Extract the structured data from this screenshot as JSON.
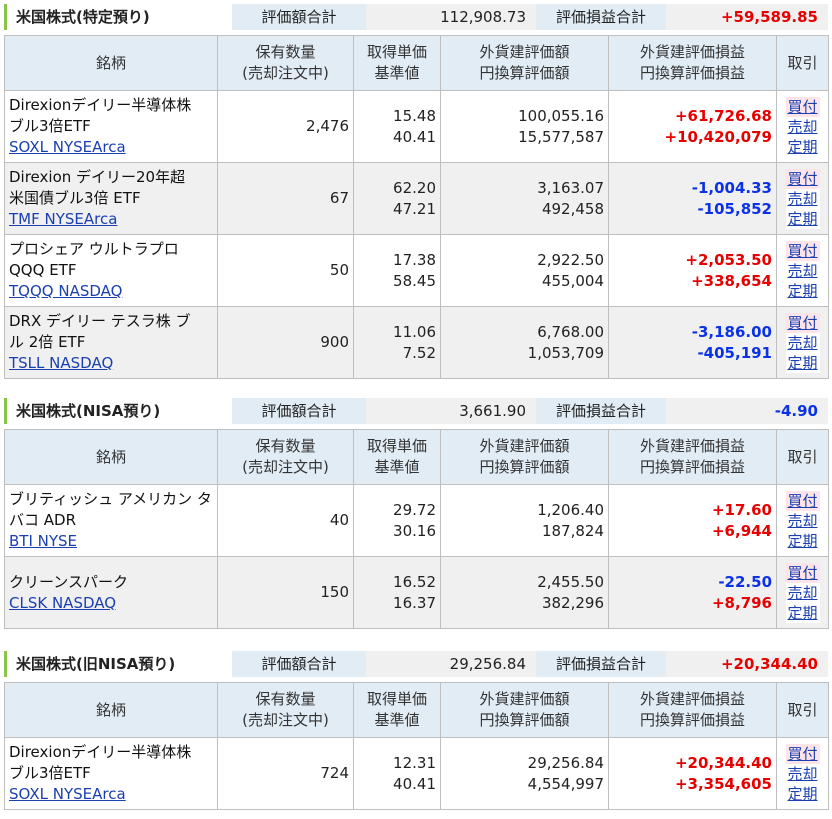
{
  "columns": {
    "name": "銘柄",
    "qty": [
      "保有数量",
      "(売却注文中)"
    ],
    "cost": [
      "取得単価",
      "基準値"
    ],
    "value": [
      "外貨建評価額",
      "円換算評価額"
    ],
    "pl": [
      "外貨建評価損益",
      "円換算評価損益"
    ],
    "trade": "取引"
  },
  "actions": {
    "buy": "買付",
    "sell": "売却",
    "fixed": "定期"
  },
  "sections": [
    {
      "title": "米国株式(特定預り)",
      "eval_label": "評価額合計",
      "eval_total": "112,908.73",
      "pl_label": "評価損益合計",
      "pl_total": "+59,589.85",
      "rows": [
        {
          "name": [
            "Direxionデイリー半導体株",
            "ブル3倍ETF"
          ],
          "ticker": "SOXL NYSEArca",
          "qty": "2,476",
          "cost": "15.48",
          "base": "40.41",
          "value_fx": "100,055.16",
          "value_jpy": "15,577,587",
          "pl_fx": "+61,726.68",
          "pl_jpy": "+10,420,079"
        },
        {
          "name": [
            "Direxion デイリー20年超",
            "米国債ブル3倍 ETF"
          ],
          "ticker": "TMF NYSEArca",
          "qty": "67",
          "cost": "62.20",
          "base": "47.21",
          "value_fx": "3,163.07",
          "value_jpy": "492,458",
          "pl_fx": "-1,004.33",
          "pl_jpy": "-105,852"
        },
        {
          "name": [
            "プロシェア ウルトラプロ",
            "QQQ ETF"
          ],
          "ticker": "TQQQ NASDAQ",
          "qty": "50",
          "cost": "17.38",
          "base": "58.45",
          "value_fx": "2,922.50",
          "value_jpy": "455,004",
          "pl_fx": "+2,053.50",
          "pl_jpy": "+338,654"
        },
        {
          "name": [
            "DRX デイリー テスラ株 ブ",
            "ル 2倍 ETF"
          ],
          "ticker": "TSLL NASDAQ",
          "qty": "900",
          "cost": "11.06",
          "base": "7.52",
          "value_fx": "6,768.00",
          "value_jpy": "1,053,709",
          "pl_fx": "-3,186.00",
          "pl_jpy": "-405,191"
        }
      ]
    },
    {
      "title": "米国株式(NISA預り)",
      "eval_label": "評価額合計",
      "eval_total": "3,661.90",
      "pl_label": "評価損益合計",
      "pl_total": "-4.90",
      "rows": [
        {
          "name": [
            "ブリティッシュ アメリカン タ",
            "バコ ADR"
          ],
          "ticker": "BTI NYSE",
          "qty": "40",
          "cost": "29.72",
          "base": "30.16",
          "value_fx": "1,206.40",
          "value_jpy": "187,824",
          "pl_fx": "+17.60",
          "pl_jpy": "+6,944"
        },
        {
          "name": [
            "クリーンスパーク"
          ],
          "ticker": "CLSK NASDAQ",
          "qty": "150",
          "cost": "16.52",
          "base": "16.37",
          "value_fx": "2,455.50",
          "value_jpy": "382,296",
          "pl_fx": "-22.50",
          "pl_jpy": "+8,796"
        }
      ]
    },
    {
      "title": "米国株式(旧NISA預り)",
      "eval_label": "評価額合計",
      "eval_total": "29,256.84",
      "pl_label": "評価損益合計",
      "pl_total": "+20,344.40",
      "rows": [
        {
          "name": [
            "Direxionデイリー半導体株",
            "ブル3倍ETF"
          ],
          "ticker": "SOXL NYSEArca",
          "qty": "724",
          "cost": "12.31",
          "base": "40.41",
          "value_fx": "29,256.84",
          "value_jpy": "4,554,997",
          "pl_fx": "+20,344.40",
          "pl_jpy": "+3,354,605"
        }
      ]
    }
  ]
}
